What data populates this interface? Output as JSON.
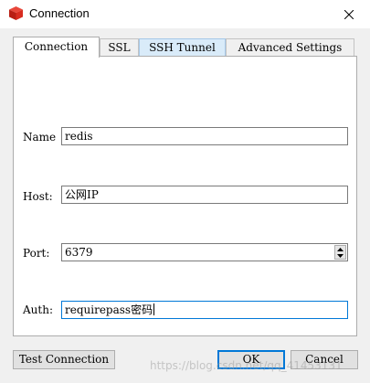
{
  "window": {
    "title": "Connection",
    "icon": "redis-cube-icon",
    "close_icon": "close-icon"
  },
  "tabs": [
    {
      "label": "Connection",
      "state": "active"
    },
    {
      "label": "SSL",
      "state": "normal"
    },
    {
      "label": "SSH Tunnel",
      "state": "hover"
    },
    {
      "label": "Advanced Settings",
      "state": "normal"
    }
  ],
  "form": {
    "name": {
      "label": "Name",
      "value": "redis"
    },
    "host": {
      "label": "Host:",
      "value": "公网IP"
    },
    "port": {
      "label": "Port:",
      "value": "6379"
    },
    "auth": {
      "label": "Auth:",
      "value": "requirepass密码"
    }
  },
  "buttons": {
    "test": "Test Connection",
    "ok": "OK",
    "cancel": "Cancel"
  },
  "watermark": "https://blog.csdn.net/qq_41453131",
  "colors": {
    "accent": "#0078d7",
    "icon_red": "#d82c20",
    "tab_hover": "#d9ebf9"
  }
}
